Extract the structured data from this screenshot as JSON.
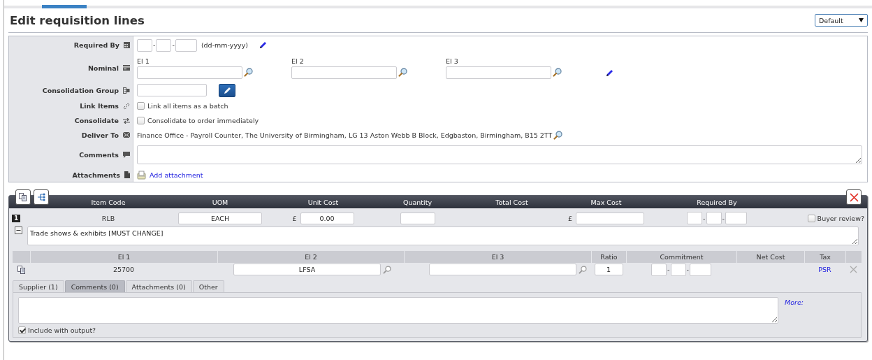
{
  "title": "Edit requisition lines",
  "view_select": {
    "value": "Default"
  },
  "form": {
    "rows": [
      {
        "kind": "date",
        "label": "Required By",
        "separator": "-",
        "hint": "(dd-mm-yyyy)"
      },
      {
        "kind": "nominal",
        "label": "Nominal",
        "fields": [
          {
            "label": "El 1"
          },
          {
            "label": "El 2"
          },
          {
            "label": "El 3"
          }
        ]
      },
      {
        "kind": "group",
        "label": "Consolidation Group"
      },
      {
        "kind": "check",
        "label": "Link Items",
        "text": "Link all items as a batch",
        "checked": false
      },
      {
        "kind": "check",
        "label": "Consolidate",
        "text": "Consolidate to order immediately",
        "checked": false
      },
      {
        "kind": "address",
        "label": "Deliver To",
        "text": "Finance Office - Payroll Counter, The University of Birmingham, LG 13 Aston Webb B Block, Edgbaston, Birmingham, B15 2TT"
      },
      {
        "kind": "textarea",
        "label": "Comments"
      },
      {
        "kind": "attachment",
        "label": "Attachments",
        "link": "Add attachment"
      }
    ]
  },
  "line": {
    "columns": [
      "Item Code",
      "UOM",
      "Unit Cost",
      "Quantity",
      "Total Cost",
      "Max Cost",
      "Required By"
    ],
    "cells": [
      {
        "kind": "badge",
        "text": "1"
      },
      {
        "kind": "text",
        "text": "RLB"
      },
      {
        "kind": "input",
        "value": "EACH"
      },
      {
        "kind": "money",
        "currency": "£",
        "value": "0.00"
      },
      {
        "kind": "input"
      },
      {
        "kind": "blank"
      },
      {
        "kind": "money",
        "currency": "£"
      },
      {
        "kind": "date",
        "separator": "-"
      },
      {
        "kind": "check",
        "label": "Buyer review?",
        "checked": false
      }
    ],
    "expanded": true,
    "description": "Trade shows & exhibits [MUST CHANGE]",
    "allocation": {
      "columns": [
        "El 1",
        "El 2",
        "El 3",
        "Ratio",
        "Commitment",
        "Net Cost",
        "Tax"
      ],
      "cells": [
        {
          "kind": "copy"
        },
        {
          "kind": "text",
          "text": "25700"
        },
        {
          "kind": "lookup",
          "value": "LFSA"
        },
        {
          "kind": "lookup"
        },
        {
          "kind": "input",
          "value": "1"
        },
        {
          "kind": "date",
          "separator": "-"
        },
        {
          "kind": "blank"
        },
        {
          "kind": "link",
          "text": "PSR"
        },
        {
          "kind": "remove"
        }
      ]
    },
    "tabs": [
      {
        "label": "Supplier (1)",
        "selected": false
      },
      {
        "label": "Comments (0)",
        "selected": true
      },
      {
        "label": "Attachments (0)",
        "selected": false
      },
      {
        "label": "Other",
        "selected": false
      }
    ],
    "more_link": "More:",
    "include_output": {
      "label": "Include with output?",
      "checked": true
    }
  }
}
